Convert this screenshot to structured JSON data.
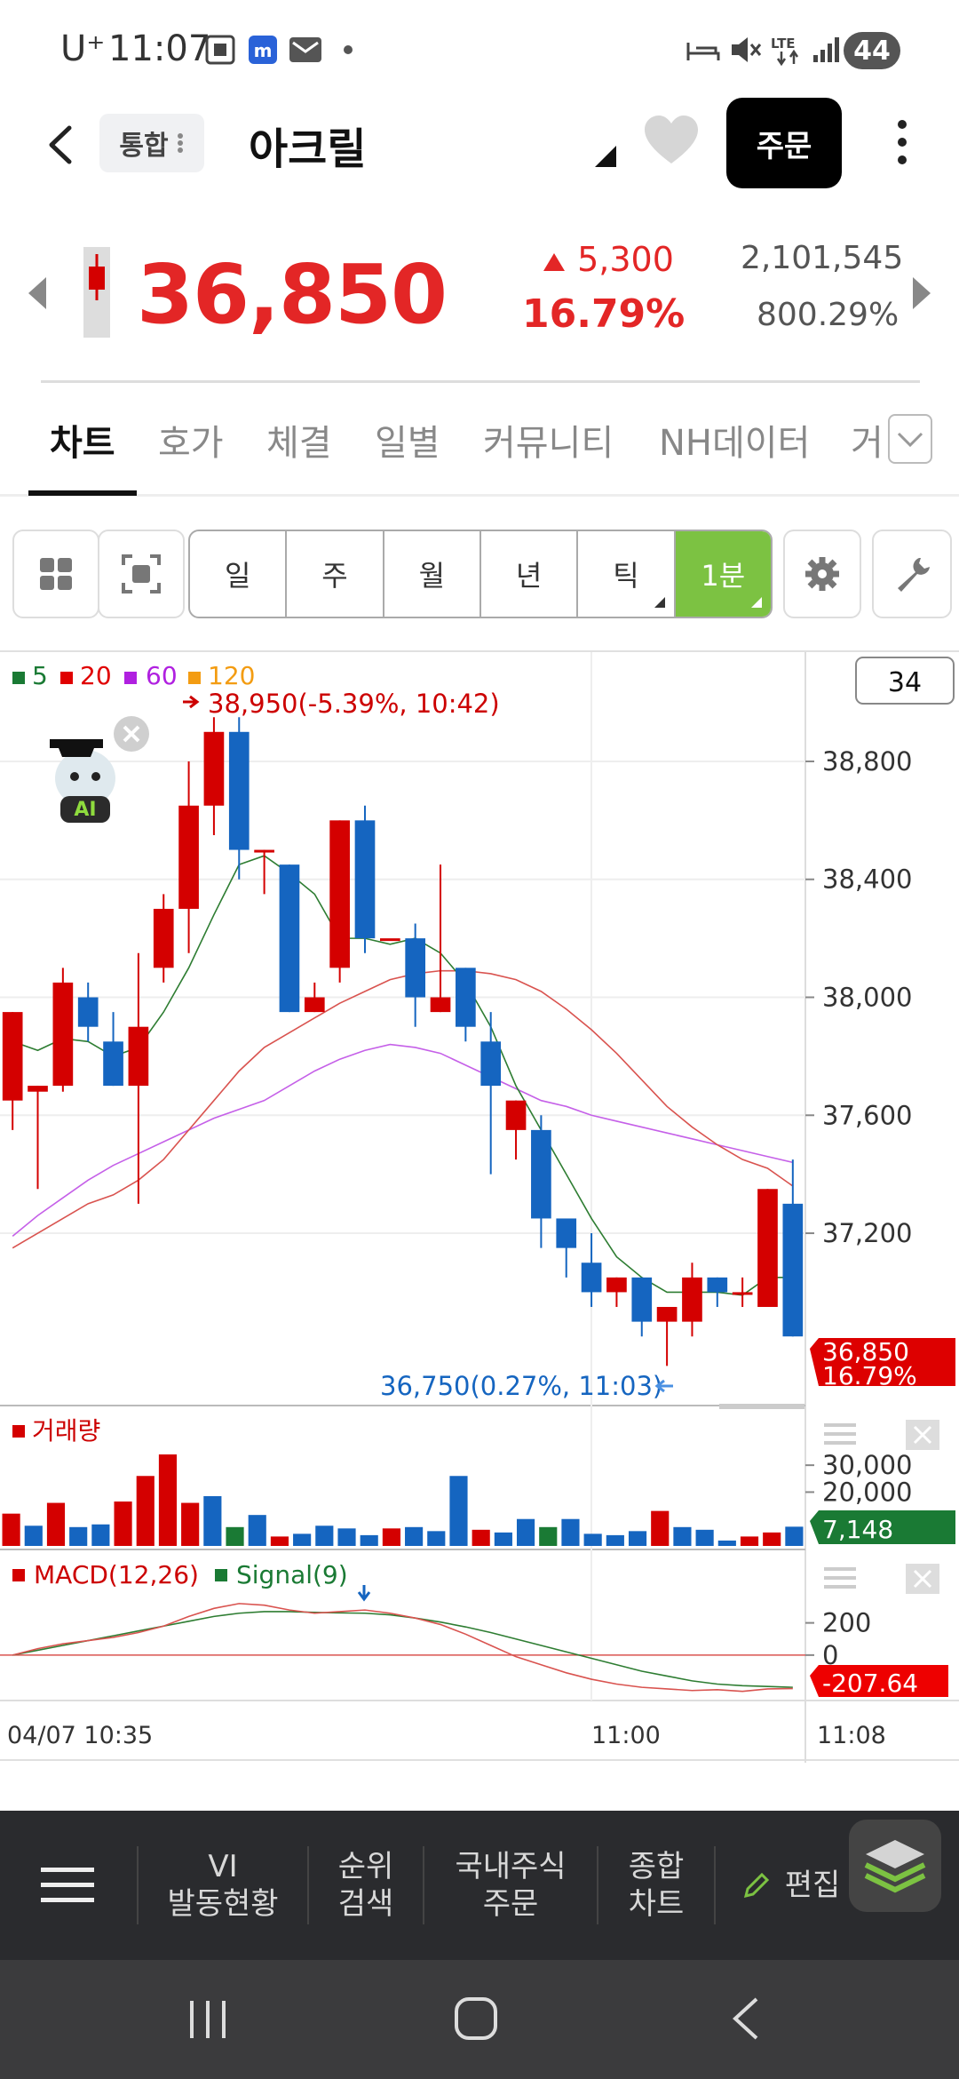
{
  "status_bar": {
    "carrier": "U⁺",
    "time": "11:07",
    "battery": "44"
  },
  "header": {
    "tag": "통합",
    "stock_name": "아크릴",
    "order_label": "주문"
  },
  "quote": {
    "price": "36,850",
    "change": "5,300",
    "change_pct": "16.79%",
    "volume": "2,101,545",
    "volume_pct": "800.29%"
  },
  "tabs": [
    "차트",
    "호가",
    "체결",
    "일별",
    "커뮤니티",
    "NH데이터",
    "거"
  ],
  "periods": [
    "일",
    "주",
    "월",
    "년",
    "틱",
    "1분"
  ],
  "chart_data": [
    {
      "type": "candlestick",
      "title": "",
      "legend": [
        "5",
        "20",
        "60",
        "120"
      ],
      "legend_colors": [
        "#1a7a34",
        "#e00000",
        "#b020e0",
        "#f39c12"
      ],
      "candle_count_box": "34",
      "y_ticks": [
        "38,800",
        "38,400",
        "38,000",
        "37,600",
        "37,200"
      ],
      "y_tick_values": [
        38800,
        38400,
        38000,
        37600,
        37200
      ],
      "ylim": [
        36700,
        39050
      ],
      "high_annotation": "38,950(-5.39%, 10:42)",
      "low_annotation": "36,750(0.27%, 11:03)",
      "last_price_label": "36,850",
      "last_pct_label": "16.79%",
      "up_color": "#d40000",
      "down_color": "#1565c0",
      "candles": [
        {
          "o": 37650,
          "h": 37950,
          "l": 37550,
          "c": 37950
        },
        {
          "o": 37680,
          "h": 37700,
          "l": 37350,
          "c": 37700
        },
        {
          "o": 37700,
          "h": 38100,
          "l": 37680,
          "c": 38050
        },
        {
          "o": 38000,
          "h": 38050,
          "l": 37850,
          "c": 37900
        },
        {
          "o": 37850,
          "h": 37950,
          "l": 37700,
          "c": 37700
        },
        {
          "o": 37700,
          "h": 38150,
          "l": 37300,
          "c": 37900
        },
        {
          "o": 38100,
          "h": 38350,
          "l": 38050,
          "c": 38300
        },
        {
          "o": 38300,
          "h": 38800,
          "l": 38150,
          "c": 38650
        },
        {
          "o": 38650,
          "h": 38950,
          "l": 38550,
          "c": 38900
        },
        {
          "o": 38900,
          "h": 38950,
          "l": 38400,
          "c": 38500
        },
        {
          "o": 38500,
          "h": 38500,
          "l": 38350,
          "c": 38500
        },
        {
          "o": 38450,
          "h": 38450,
          "l": 37950,
          "c": 37950
        },
        {
          "o": 37950,
          "h": 38050,
          "l": 37950,
          "c": 38000
        },
        {
          "o": 38100,
          "h": 38600,
          "l": 38050,
          "c": 38600
        },
        {
          "o": 38600,
          "h": 38650,
          "l": 38150,
          "c": 38200
        },
        {
          "o": 38200,
          "h": 38200,
          "l": 38200,
          "c": 38200
        },
        {
          "o": 38200,
          "h": 38250,
          "l": 37900,
          "c": 38000
        },
        {
          "o": 37950,
          "h": 38450,
          "l": 37950,
          "c": 38000
        },
        {
          "o": 38100,
          "h": 38100,
          "l": 37850,
          "c": 37900
        },
        {
          "o": 37850,
          "h": 37950,
          "l": 37400,
          "c": 37700
        },
        {
          "o": 37550,
          "h": 37650,
          "l": 37450,
          "c": 37650
        },
        {
          "o": 37550,
          "h": 37600,
          "l": 37150,
          "c": 37250
        },
        {
          "o": 37250,
          "h": 37250,
          "l": 37050,
          "c": 37150
        },
        {
          "o": 37100,
          "h": 37200,
          "l": 36950,
          "c": 37000
        },
        {
          "o": 37000,
          "h": 37050,
          "l": 36950,
          "c": 37050
        },
        {
          "o": 37050,
          "h": 37050,
          "l": 36850,
          "c": 36900
        },
        {
          "o": 36900,
          "h": 36950,
          "l": 36750,
          "c": 36950
        },
        {
          "o": 36900,
          "h": 37100,
          "l": 36850,
          "c": 37050
        },
        {
          "o": 37050,
          "h": 37050,
          "l": 36950,
          "c": 37000
        },
        {
          "o": 37000,
          "h": 37050,
          "l": 36950,
          "c": 37000
        },
        {
          "o": 36950,
          "h": 37350,
          "l": 36950,
          "c": 37350
        },
        {
          "o": 37300,
          "h": 37450,
          "l": 36850,
          "c": 36850
        }
      ],
      "ma5": [
        37850,
        37820,
        37860,
        37850,
        37800,
        37830,
        37950,
        38100,
        38280,
        38450,
        38480,
        38420,
        38350,
        38200,
        38200,
        38180,
        38200,
        38150,
        38050,
        37900,
        37700,
        37550,
        37400,
        37250,
        37120,
        37050,
        37000,
        37000,
        37000,
        36990,
        37050,
        37050
      ],
      "ma20": [
        37150,
        37200,
        37250,
        37300,
        37330,
        37380,
        37450,
        37550,
        37650,
        37750,
        37830,
        37880,
        37930,
        37980,
        38020,
        38060,
        38080,
        38090,
        38090,
        38080,
        38060,
        38020,
        37960,
        37890,
        37810,
        37720,
        37630,
        37560,
        37500,
        37450,
        37420,
        37360
      ],
      "ma60": [
        37190,
        37260,
        37320,
        37380,
        37430,
        37470,
        37510,
        37550,
        37590,
        37620,
        37650,
        37700,
        37750,
        37790,
        37820,
        37840,
        37830,
        37810,
        37770,
        37730,
        37690,
        37650,
        37630,
        37600,
        37580,
        37560,
        37540,
        37520,
        37500,
        37480,
        37460,
        37440
      ]
    },
    {
      "type": "bar",
      "title": "거래량",
      "y_ticks": [
        "30,000",
        "20,000"
      ],
      "y_tick_values": [
        30000,
        20000
      ],
      "ylim": [
        0,
        35000
      ],
      "last_value_label": "7,148",
      "values": [
        12000,
        7500,
        16000,
        7000,
        8000,
        16500,
        26000,
        34000,
        16000,
        18500,
        7000,
        11500,
        3500,
        4500,
        7500,
        6500,
        4000,
        6500,
        7000,
        5500,
        26000,
        6000,
        5000,
        10000,
        7000,
        10000,
        4500,
        4000,
        5500,
        13000,
        7000,
        6000,
        2000,
        3500,
        5000,
        7148
      ],
      "colors": [
        "r",
        "b",
        "r",
        "b",
        "b",
        "r",
        "r",
        "r",
        "r",
        "b",
        "g",
        "b",
        "r",
        "b",
        "b",
        "b",
        "b",
        "r",
        "b",
        "b",
        "b",
        "r",
        "b",
        "b",
        "g",
        "b",
        "b",
        "b",
        "b",
        "r",
        "b",
        "b",
        "b",
        "r",
        "r",
        "b"
      ]
    },
    {
      "type": "line",
      "title": "MACD",
      "series_labels": [
        "MACD(12,26)",
        "Signal(9)"
      ],
      "y_ticks": [
        "200",
        "0"
      ],
      "y_tick_values": [
        200,
        0
      ],
      "ylim": [
        -260,
        380
      ],
      "last_value_label": "-207.64",
      "x_labels": [
        "04/07 10:35",
        "11:00",
        "11:08"
      ],
      "macd": [
        0,
        40,
        70,
        90,
        110,
        140,
        180,
        240,
        290,
        320,
        310,
        280,
        260,
        270,
        280,
        260,
        230,
        190,
        130,
        60,
        -10,
        -60,
        -110,
        -150,
        -180,
        -200,
        -210,
        -220,
        -215,
        -225,
        -210,
        -208
      ],
      "signal": [
        0,
        30,
        60,
        90,
        120,
        150,
        180,
        210,
        240,
        260,
        270,
        270,
        265,
        262,
        260,
        250,
        230,
        205,
        175,
        140,
        100,
        60,
        20,
        -20,
        -60,
        -100,
        -130,
        -160,
        -180,
        -190,
        -195,
        -200
      ]
    }
  ],
  "bottom_nav": [
    "VI\n발동현황",
    "순위\n검색",
    "국내주식\n주문",
    "종합\n차트",
    "편집"
  ]
}
